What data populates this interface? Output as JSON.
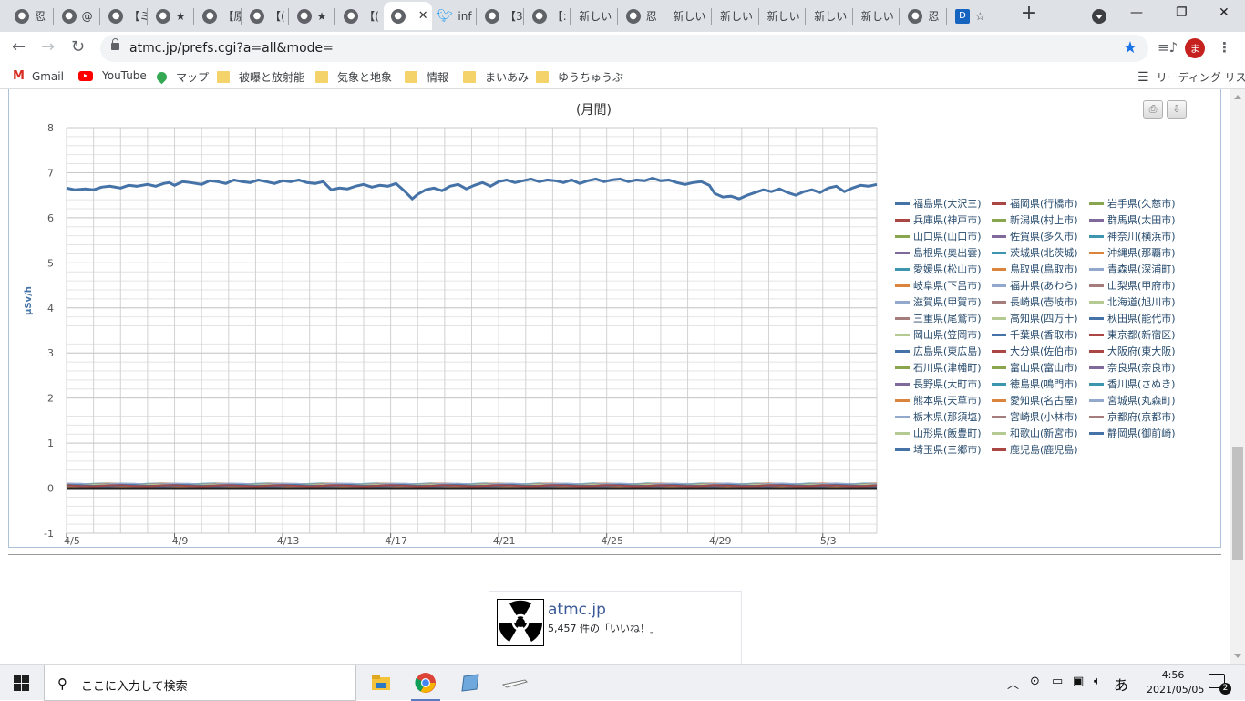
{
  "browser": {
    "tabs": [
      {
        "icon": "globe-icon",
        "title": "忍"
      },
      {
        "icon": "globe-icon",
        "title": "@"
      },
      {
        "icon": "globe-icon",
        "title": "【ミ"
      },
      {
        "icon": "globe-icon",
        "title": "★"
      },
      {
        "icon": "globe-icon",
        "title": "【原"
      },
      {
        "icon": "globe-icon",
        "title": "【("
      },
      {
        "icon": "globe-icon",
        "title": "★"
      },
      {
        "icon": "globe-icon",
        "title": "【("
      },
      {
        "icon": "globe-icon",
        "title": "",
        "active": true
      },
      {
        "icon": "twitter-icon",
        "title": "inf"
      },
      {
        "icon": "globe-icon",
        "title": "【3"
      },
      {
        "icon": "globe-icon",
        "title": "【:"
      },
      {
        "icon": "none",
        "title": "新しい"
      },
      {
        "icon": "globe-icon",
        "title": "忍"
      },
      {
        "icon": "none",
        "title": "新しい"
      },
      {
        "icon": "none",
        "title": "新しい"
      },
      {
        "icon": "none",
        "title": "新しい"
      },
      {
        "icon": "none",
        "title": "新しい"
      },
      {
        "icon": "none",
        "title": "新しい"
      },
      {
        "icon": "globe-icon",
        "title": "忍"
      },
      {
        "icon": "dn-icon",
        "title": "☆"
      }
    ],
    "url": "atmc.jp/prefs.cgi?a=all&mode=",
    "avatar_initial": "ま",
    "bookmarks": [
      "Gmail",
      "YouTube",
      "マップ",
      "被曝と放射能",
      "気象と地象",
      "情報",
      "まいあみ",
      "ゆうちゅうぶ"
    ],
    "reading_list": "リーディング リスト"
  },
  "chart_data": {
    "type": "line",
    "title": "(月間)",
    "ylabel": "μSv/h",
    "ylim": [
      -1,
      8
    ],
    "yticks": [
      -1,
      0,
      1,
      2,
      3,
      4,
      5,
      6,
      7,
      8
    ],
    "xlim": [
      0,
      30
    ],
    "xticks": [
      {
        "label": "4/5",
        "x": 0
      },
      {
        "label": "4/9",
        "x": 4
      },
      {
        "label": "4/13",
        "x": 8
      },
      {
        "label": "4/17",
        "x": 12
      },
      {
        "label": "4/21",
        "x": 16
      },
      {
        "label": "4/25",
        "x": 20
      },
      {
        "label": "4/29",
        "x": 24
      },
      {
        "label": "5/3",
        "x": 28
      }
    ],
    "series": [
      {
        "name": "福島県(大沢三)",
        "color": "#4572a7",
        "x": [
          0,
          0.3,
          0.7,
          1,
          1.3,
          1.6,
          2,
          2.3,
          2.6,
          3,
          3.3,
          3.6,
          3.8,
          4,
          4.3,
          4.6,
          5,
          5.3,
          5.6,
          5.9,
          6.2,
          6.5,
          6.8,
          7.1,
          7.4,
          7.7,
          8,
          8.3,
          8.6,
          8.9,
          9.2,
          9.5,
          9.8,
          10.1,
          10.4,
          10.7,
          11,
          11.3,
          11.6,
          11.9,
          12.2,
          12.5,
          12.8,
          13,
          13.3,
          13.6,
          13.9,
          14.2,
          14.5,
          14.8,
          15.1,
          15.4,
          15.7,
          16,
          16.3,
          16.6,
          16.9,
          17.2,
          17.5,
          17.8,
          18.1,
          18.4,
          18.7,
          19,
          19.3,
          19.6,
          19.9,
          20.2,
          20.5,
          20.8,
          21.1,
          21.4,
          21.7,
          22,
          22.3,
          22.6,
          22.9,
          23.2,
          23.5,
          23.8,
          24,
          24.3,
          24.6,
          24.9,
          25.2,
          25.5,
          25.8,
          26.1,
          26.4,
          26.7,
          27,
          27.3,
          27.6,
          27.9,
          28.2,
          28.5,
          28.8,
          29.1,
          29.4,
          29.7,
          30
        ],
        "y": [
          6.66,
          6.62,
          6.64,
          6.62,
          6.68,
          6.7,
          6.66,
          6.72,
          6.7,
          6.74,
          6.7,
          6.76,
          6.78,
          6.72,
          6.8,
          6.78,
          6.74,
          6.82,
          6.8,
          6.76,
          6.84,
          6.8,
          6.78,
          6.84,
          6.8,
          6.76,
          6.82,
          6.8,
          6.84,
          6.78,
          6.76,
          6.8,
          6.62,
          6.66,
          6.64,
          6.7,
          6.74,
          6.68,
          6.72,
          6.7,
          6.76,
          6.6,
          6.42,
          6.52,
          6.62,
          6.66,
          6.6,
          6.7,
          6.74,
          6.64,
          6.72,
          6.78,
          6.7,
          6.8,
          6.84,
          6.78,
          6.82,
          6.86,
          6.8,
          6.84,
          6.82,
          6.78,
          6.84,
          6.76,
          6.82,
          6.86,
          6.8,
          6.84,
          6.86,
          6.8,
          6.84,
          6.82,
          6.88,
          6.82,
          6.84,
          6.78,
          6.74,
          6.78,
          6.8,
          6.72,
          6.54,
          6.46,
          6.48,
          6.42,
          6.5,
          6.56,
          6.62,
          6.58,
          6.64,
          6.56,
          6.5,
          6.58,
          6.62,
          6.56,
          6.66,
          6.7,
          6.58,
          6.66,
          6.72,
          6.7,
          6.74
        ]
      },
      {
        "name": "福岡県(行橋市)",
        "color": "#aa4643",
        "baseline": 0.04
      },
      {
        "name": "岩手県(久慈市)",
        "color": "#89a54e",
        "baseline": 0.05
      },
      {
        "name": "兵庫県(神戸市)",
        "color": "#aa4643",
        "baseline": 0.08
      },
      {
        "name": "新潟県(村上市)",
        "color": "#89a54e",
        "baseline": 0.06
      },
      {
        "name": "群馬県(太田市)",
        "color": "#80699b",
        "baseline": 0.05
      },
      {
        "name": "山口県(山口市)",
        "color": "#89a54e",
        "baseline": 0.07
      },
      {
        "name": "佐賀県(多久市)",
        "color": "#80699b",
        "baseline": 0.05
      },
      {
        "name": "神奈川(横浜市)",
        "color": "#3d96ae",
        "baseline": 0.04
      },
      {
        "name": "島根県(奥出雲)",
        "color": "#80699b",
        "baseline": 0.07
      },
      {
        "name": "茨城県(北茨城)",
        "color": "#3d96ae",
        "baseline": 0.08
      },
      {
        "name": "沖縄県(那覇市)",
        "color": "#db843d",
        "baseline": 0.03
      },
      {
        "name": "愛媛県(松山市)",
        "color": "#3d96ae",
        "baseline": 0.06
      },
      {
        "name": "鳥取県(鳥取市)",
        "color": "#db843d",
        "baseline": 0.06
      },
      {
        "name": "青森県(深浦町)",
        "color": "#92a8cd",
        "baseline": 0.04
      },
      {
        "name": "岐阜県(下呂市)",
        "color": "#db843d",
        "baseline": 0.08
      },
      {
        "name": "福井県(あわら)",
        "color": "#92a8cd",
        "baseline": 0.06
      },
      {
        "name": "山梨県(甲府市)",
        "color": "#a47d7c",
        "baseline": 0.05
      },
      {
        "name": "滋賀県(甲賀市)",
        "color": "#92a8cd",
        "baseline": 0.06
      },
      {
        "name": "長崎県(壱岐市)",
        "color": "#a47d7c",
        "baseline": 0.04
      },
      {
        "name": "北海道(旭川市)",
        "color": "#b5ca92",
        "baseline": 0.03
      },
      {
        "name": "三重県(尾鷲市)",
        "color": "#a47d7c",
        "baseline": 0.05
      },
      {
        "name": "高知県(四万十)",
        "color": "#b5ca92",
        "baseline": 0.05
      },
      {
        "name": "秋田県(能代市)",
        "color": "#4572a7",
        "baseline": 0.04
      },
      {
        "name": "岡山県(笠岡市)",
        "color": "#b5ca92",
        "baseline": 0.06
      },
      {
        "name": "千葉県(香取市)",
        "color": "#4572a7",
        "baseline": 0.05
      },
      {
        "name": "東京都(新宿区)",
        "color": "#aa4643",
        "baseline": 0.04
      },
      {
        "name": "広島県(東広島)",
        "color": "#4572a7",
        "baseline": 0.06
      },
      {
        "name": "大分県(佐伯市)",
        "color": "#aa4643",
        "baseline": 0.05
      },
      {
        "name": "大阪府(東大阪)",
        "color": "#aa4643",
        "baseline": 0.05
      },
      {
        "name": "石川県(津幡町)",
        "color": "#89a54e",
        "baseline": 0.06
      },
      {
        "name": "富山県(富山市)",
        "color": "#89a54e",
        "baseline": 0.06
      },
      {
        "name": "奈良県(奈良市)",
        "color": "#80699b",
        "baseline": 0.06
      },
      {
        "name": "長野県(大町市)",
        "color": "#80699b",
        "baseline": 0.05
      },
      {
        "name": "徳島県(鳴門市)",
        "color": "#3d96ae",
        "baseline": 0.05
      },
      {
        "name": "香川県(さぬき)",
        "color": "#3d96ae",
        "baseline": 0.06
      },
      {
        "name": "熊本県(天草市)",
        "color": "#db843d",
        "baseline": 0.04
      },
      {
        "name": "愛知県(名古屋)",
        "color": "#db843d",
        "baseline": 0.04
      },
      {
        "name": "宮城県(丸森町)",
        "color": "#92a8cd",
        "baseline": 0.07
      },
      {
        "name": "栃木県(那須塩)",
        "color": "#92a8cd",
        "baseline": 0.08
      },
      {
        "name": "宮崎県(小林市)",
        "color": "#a47d7c",
        "baseline": 0.04
      },
      {
        "name": "京都府(京都市)",
        "color": "#a47d7c",
        "baseline": 0.05
      },
      {
        "name": "山形県(飯豊町)",
        "color": "#b5ca92",
        "baseline": 0.05
      },
      {
        "name": "和歌山(新宮市)",
        "color": "#b5ca92",
        "baseline": 0.05
      },
      {
        "name": "静岡県(御前崎)",
        "color": "#4572a7",
        "baseline": 0.04
      },
      {
        "name": "埼玉県(三郷市)",
        "color": "#4572a7",
        "baseline": 0.05
      },
      {
        "name": "鹿児島(鹿児島)",
        "color": "#aa4643",
        "baseline": 0.04
      }
    ]
  },
  "facebook": {
    "name": "atmc.jp",
    "likes": "5,457 件の「いいね！」"
  },
  "taskbar": {
    "search_placeholder": "ここに入力して検索",
    "time": "4:56",
    "date": "2021/05/05",
    "ime": "あ",
    "notifications": "2"
  }
}
